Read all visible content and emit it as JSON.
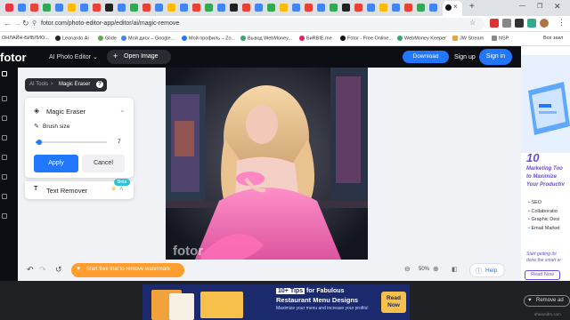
{
  "browser": {
    "url": "fotor.com/photo-editor-app/editor/ai/magic-remove",
    "bookmarks": [
      "ОНЛАЙН-БИБЛИО...",
      "Leonardo.Ai",
      "Glide",
      "Мой диск – Google...",
      "Мой профиль – Zo...",
      "Вывод WebMoney...",
      "БиRBIE.me",
      "Fotor - Free Online...",
      "WebMoney Keeper",
      "JW Stream",
      "NSP",
      "Все закл"
    ]
  },
  "header": {
    "logo": "fotor",
    "product_menu": "AI Photo Editor",
    "open_image": "Open Image",
    "download": "Download",
    "signup": "Sign up",
    "signin": "Sign in"
  },
  "breadcrumb": {
    "parent": "AI Tools",
    "current": "Magic Eraser"
  },
  "tool_panel": {
    "title": "Magic Eraser",
    "brush_label": "Brush size",
    "brush_value": "7",
    "brush_fraction": 0.05,
    "apply": "Apply",
    "cancel": "Cancel",
    "next_tool": "Text Remover",
    "next_badge": "Beta"
  },
  "canvas": {
    "watermark": "fotor"
  },
  "bottom": {
    "trial": "Start free trial to remove watermark",
    "zoom": "50%",
    "help": "Help"
  },
  "side_ad": {
    "number": "10",
    "headline": [
      "Marketing Too",
      "to Maximize",
      "Your Productiv"
    ],
    "bullets": [
      "SEO",
      "Collaboratio",
      "Graphic Desi",
      "Email Market"
    ],
    "footer": [
      "Start getting thi",
      "done the smart w"
    ],
    "read_now": "Read Now",
    "remove": "Remove ad"
  },
  "bottom_ad": {
    "tips_badge": "10+ Tips",
    "headline_suffix": "for Fabulous",
    "headline_line2": "Restaurant Menu Designs",
    "sub": "Maximize your menu and increase your profits!",
    "read_now": "Read Now",
    "remove": "Remove ad",
    "brand": "shearedm.com"
  },
  "colors": {
    "brand_blue": "#2277ff",
    "app_dark": "#0d0e13",
    "trial_orange": "#ff9d2e"
  }
}
